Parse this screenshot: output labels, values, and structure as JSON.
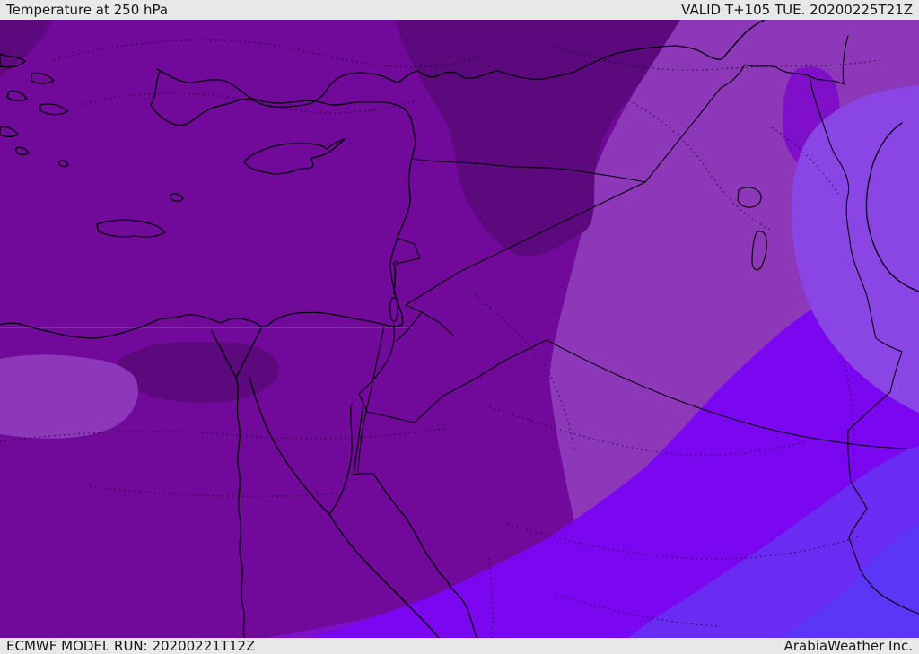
{
  "header": {
    "title": "Temperature at 250 hPa",
    "valid": "VALID T+105 TUE. 20200225T21Z"
  },
  "footer": {
    "model_run": "ECMWF MODEL RUN: 20200221T12Z",
    "attribution": "ArabiaWeather Inc."
  },
  "colors": {
    "bar_bg": "#e8e8e8",
    "bar_text": "#161616",
    "coastline": "#000000",
    "band_darkest_purple": "#5c097e",
    "band_main_purple": "#71099b",
    "band_lavender_purple": "#8c38b8",
    "band_vivid_purple": "#7f0fc9",
    "band_vivid_violet": "#7a07f0",
    "band_light_violet": "#8a45e5",
    "band_blue_violet": "#6a2bf2",
    "band_bright_blue": "#5b36f6"
  }
}
